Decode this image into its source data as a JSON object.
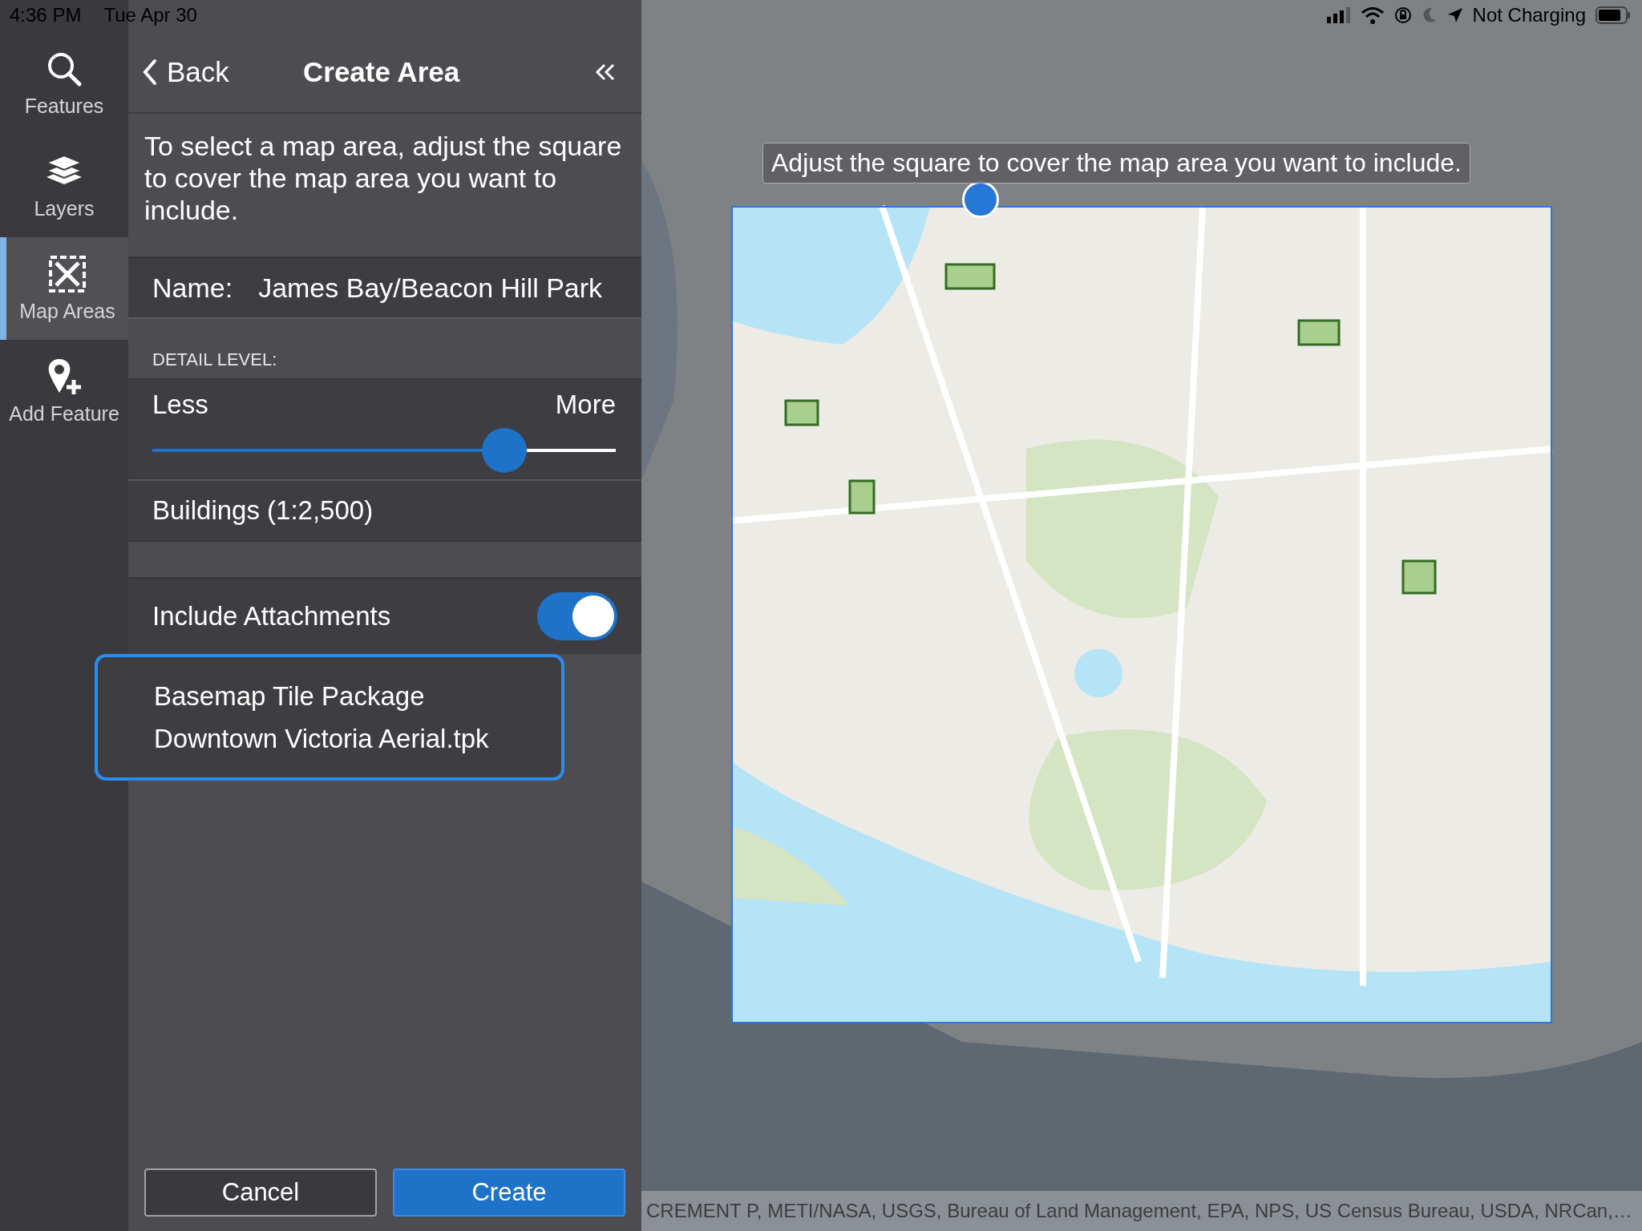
{
  "status_bar": {
    "time": "4:36 PM",
    "date": "Tue Apr 30",
    "battery_text": "Not Charging"
  },
  "rail": [
    {
      "label": "Features",
      "selected": false
    },
    {
      "label": "Layers",
      "selected": false
    },
    {
      "label": "Map Areas",
      "selected": true
    },
    {
      "label": "Add Feature",
      "selected": false
    }
  ],
  "panel": {
    "back": "Back",
    "title": "Create Area",
    "description": "To select a map area, adjust the square to cover the map area you want to include.",
    "name_label": "Name:",
    "name_value": "James Bay/Beacon Hill Park",
    "detail_label": "DETAIL LEVEL:",
    "slider": {
      "min_label": "Less",
      "max_label": "More",
      "level": 0.76
    },
    "scale_text": "Buildings (1:2,500)",
    "attachments": {
      "label": "Include Attachments",
      "on": true
    },
    "basemap": {
      "title": "Basemap Tile Package",
      "file": "Downtown Victoria Aerial.tpk",
      "selected": true
    },
    "buttons": [
      {
        "label": "Cancel",
        "kind": "secondary"
      },
      {
        "label": "Create",
        "kind": "primary"
      }
    ]
  },
  "map": {
    "kind": "picture",
    "tip": "Adjust the square to cover the map area you want to include.",
    "attribution": "CREMENT P, METI/NASA, USGS, Bureau of Land Management, EPA, NPS, US Census Bureau, USDA, NRCan,…"
  }
}
